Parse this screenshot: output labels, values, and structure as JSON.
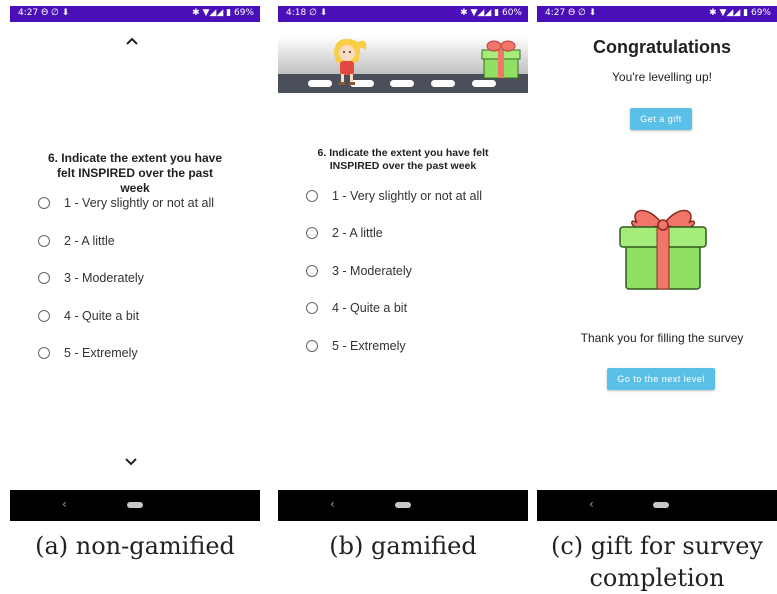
{
  "panels": {
    "a": {
      "status_time": "4:27",
      "status_icons_left": "Θ ∅ ⬇",
      "status_icons_right": "✱ ▼◢◢",
      "battery": "69%",
      "up_icon": "chevron-up-icon",
      "down_icon": "chevron-down-icon",
      "question": "6. Indicate the extent you have felt INSPIRED over the past week",
      "options": [
        "1 - Very slightly or not at all",
        "2 - A little",
        "3 - Moderately",
        "4 - Quite a bit",
        "5 - Extremely"
      ],
      "caption": "(a) non-gamified"
    },
    "b": {
      "status_time": "4:18",
      "status_icons_left": "∅ ⬇",
      "status_icons_right": "✱ ▼◢◢",
      "battery": "60%",
      "question": "6. Indicate the extent you have felt INSPIRED over the past week",
      "options": [
        "1 - Very slightly or not at all",
        "2 - A little",
        "3 - Moderately",
        "4 - Quite a bit",
        "5 - Extremely"
      ],
      "caption": "(b) gamified"
    },
    "c": {
      "status_time": "4:27",
      "status_icons_left": "Θ ∅ ⬇",
      "status_icons_right": "✱ ▼◢◢",
      "battery": "69%",
      "title": "Congratulations",
      "subtitle": "You're levelling up!",
      "gift_button": "Get a gift",
      "thank_you": "Thank you for filling the survey",
      "next_button": "Go to the next level",
      "caption": "(c) gift for survey completion"
    }
  },
  "colors": {
    "status_bar": "#4a0fb8",
    "button": "#5bc0e8",
    "gift_box": "#8fe063",
    "gift_ribbon": "#f2756a"
  }
}
